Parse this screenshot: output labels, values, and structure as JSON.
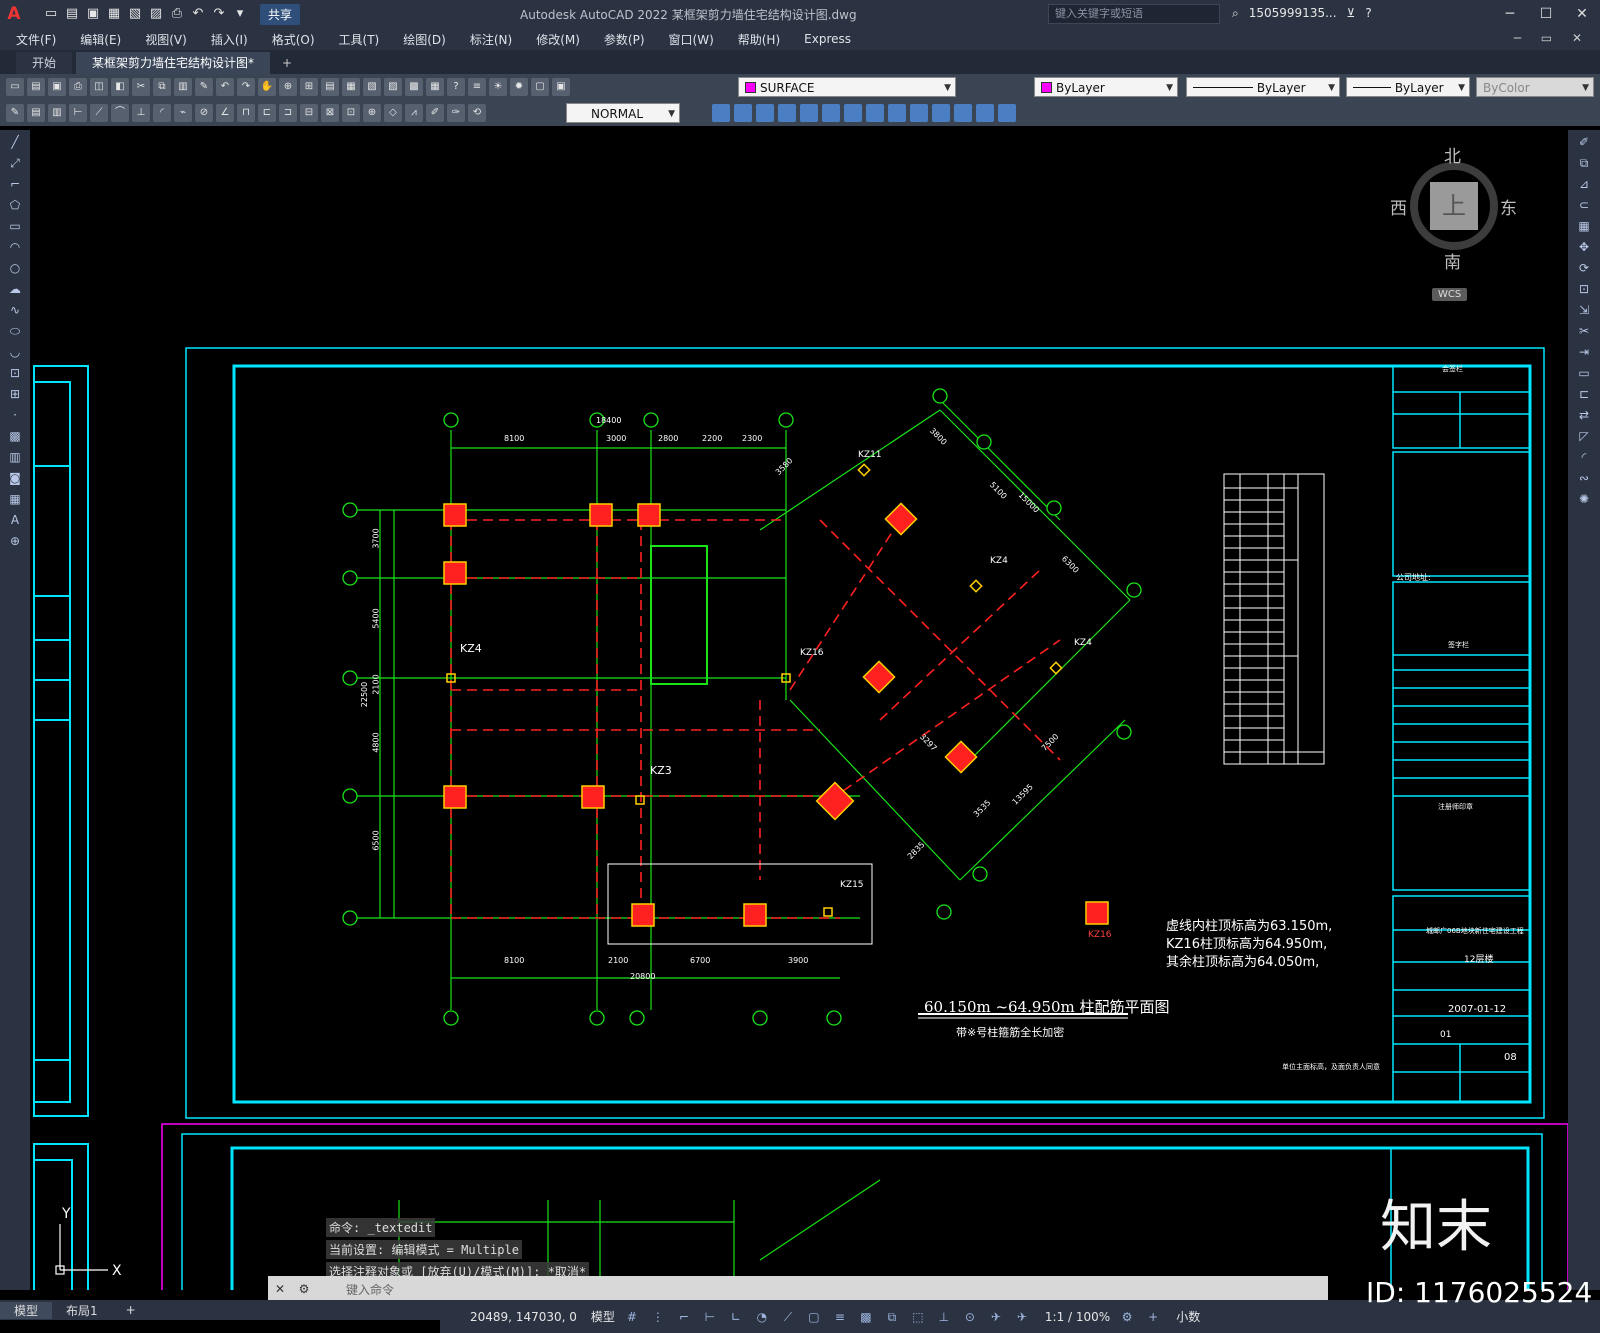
{
  "window": {
    "app_title": "Autodesk AutoCAD 2022    某框架剪力墙住宅结构设计图.dwg",
    "share_label": "共享",
    "search_placeholder": "键入关键字或短语",
    "user": "1505999135...",
    "controls": [
      "─",
      "☐",
      "✕"
    ]
  },
  "menu": [
    "文件(F)",
    "编辑(E)",
    "视图(V)",
    "插入(I)",
    "格式(O)",
    "工具(T)",
    "绘图(D)",
    "标注(N)",
    "修改(M)",
    "参数(P)",
    "窗口(W)",
    "帮助(H)",
    "Express"
  ],
  "tabs": {
    "start": "开始",
    "doc": "某框架剪力墙住宅结构设计图*",
    "add": "+"
  },
  "properties": {
    "layer": "SURFACE",
    "layer_color": "#ff00ff",
    "color": "ByLayer",
    "linetype": "ByLayer",
    "lineweight": "ByLayer",
    "plotstyle": "ByColor",
    "text_style": "NORMAL"
  },
  "viewcube": {
    "north": "北",
    "south": "南",
    "east": "东",
    "west": "西",
    "face": "上",
    "wcs": "WCS"
  },
  "drawing": {
    "title": "60.150m ~64.950m 柱配筋平面图",
    "subtitle": "带※号柱箍筋全长加密",
    "notes": [
      "虚线内柱顶标高为63.150m,",
      "KZ16柱顶标高为64.950m,",
      "其余柱顶标高为64.050m,"
    ],
    "top_dims": [
      "18400",
      "8100",
      "3000",
      "2800",
      "2200",
      "2300"
    ],
    "bottom_dims": [
      "8100",
      "2100",
      "6700",
      "3900",
      "20800"
    ],
    "left_dims": [
      "3700",
      "5400",
      "2100",
      "4800",
      "22500",
      "6500"
    ],
    "diag_dims": [
      "3800",
      "5100",
      "15000",
      "6300",
      "3580",
      "7500",
      "3535",
      "2835",
      "13595",
      "3297"
    ],
    "columns": [
      "KZ4",
      "KZ11",
      "KZ16",
      "KZ3",
      "KZ4",
      "KZ4",
      "KZ15",
      "KZ16"
    ],
    "date": "2007-01-12",
    "project": "城邮广06B地块新住宅建设工程",
    "subproject": "12层楼",
    "drawing_no": "08",
    "edition": "01",
    "unit_note": "单位主面标高，及面负责人同意",
    "company_label": "公司地址:",
    "countersign": "会签栏",
    "sign": "签字栏",
    "seal": "注册师印章"
  },
  "command": {
    "history": [
      "命令: _textedit",
      "当前设置: 编辑模式 = Multiple",
      "选择注释对象或 [放弃(U)/模式(M)]: *取消*"
    ],
    "placeholder": "键入命令"
  },
  "layout_tabs": [
    "模型",
    "布局1",
    "+"
  ],
  "status": {
    "coords": "20489, 147030, 0",
    "space": "模型",
    "scale": "1:1 / 100%",
    "units": "小数"
  },
  "watermark": {
    "brand": "知末",
    "id": "ID: 1176025524"
  }
}
